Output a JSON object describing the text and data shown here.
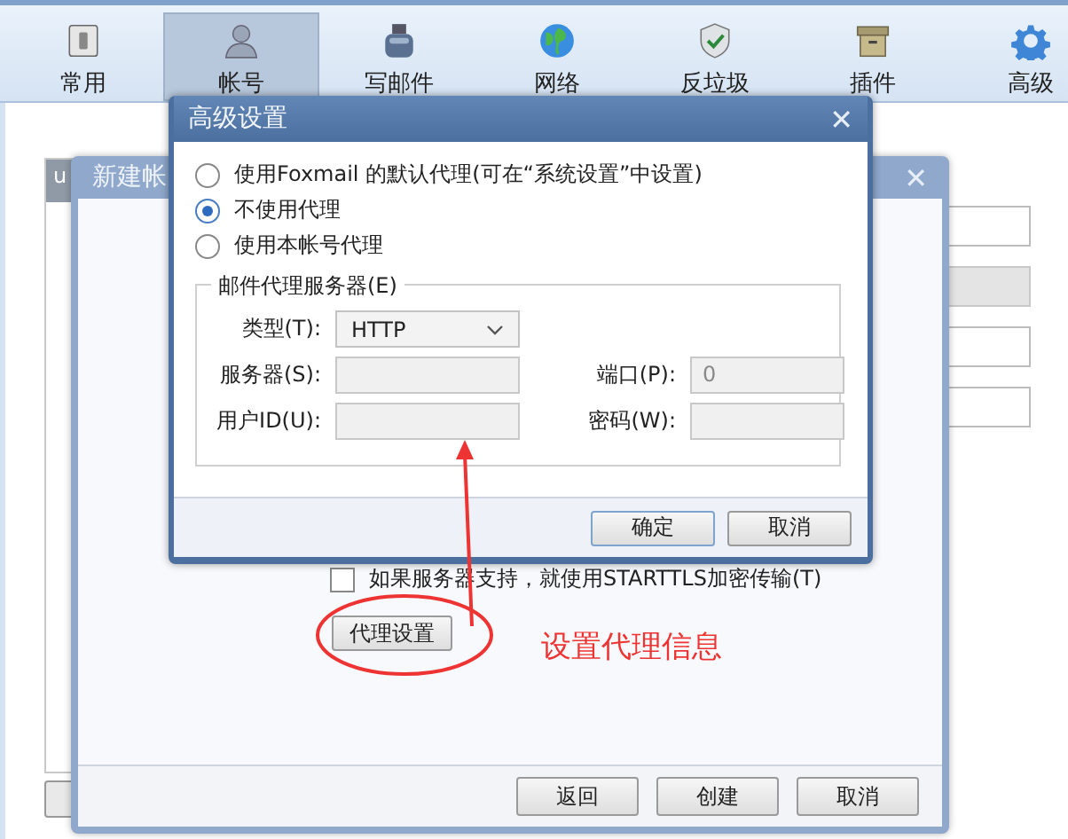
{
  "toolbar": {
    "items": [
      {
        "kind": "general",
        "label": "常用",
        "selected": false
      },
      {
        "kind": "account",
        "label": "帐号",
        "selected": true
      },
      {
        "kind": "compose",
        "label": "写邮件",
        "selected": false
      },
      {
        "kind": "network",
        "label": "网络",
        "selected": false
      },
      {
        "kind": "antispam",
        "label": "反垃圾",
        "selected": false
      },
      {
        "kind": "plugin",
        "label": "插件",
        "selected": false
      },
      {
        "kind": "advanced",
        "label": "高级",
        "selected": false
      }
    ]
  },
  "main_window": {
    "list_header": "u",
    "fields": [
      {
        "disabled": false
      },
      {
        "disabled": true
      },
      {
        "disabled": false
      },
      {
        "disabled": false
      }
    ]
  },
  "new_account_dialog": {
    "title": "新建帐",
    "starttls": {
      "label": "如果服务器支持，就使用STARTTLS加密传输(T)",
      "checked": false
    },
    "proxy_button": "代理设置",
    "buttons": [
      "返回",
      "创建",
      "取消"
    ]
  },
  "advanced_dialog": {
    "title": "高级设置",
    "close": "✕",
    "proxy_options": [
      {
        "label": "使用Foxmail 的默认代理(可在“系统设置”中设置)",
        "selected": false
      },
      {
        "label": "不使用代理",
        "selected": true
      },
      {
        "label": "使用本帐号代理",
        "selected": false
      }
    ],
    "group": {
      "title": "邮件代理服务器(E)",
      "type": {
        "label": "类型(T):",
        "value": "HTTP"
      },
      "server": {
        "label": "服务器(S):",
        "disabled": true
      },
      "port": {
        "label": "端口(P):",
        "value": "0",
        "disabled": true
      },
      "user_id": {
        "label": "用户ID(U):",
        "disabled": true
      },
      "password": {
        "label": "密码(W):",
        "disabled": true
      }
    },
    "buttons": [
      "确定",
      "取消"
    ]
  },
  "annotation": {
    "text": "设置代理信息"
  }
}
